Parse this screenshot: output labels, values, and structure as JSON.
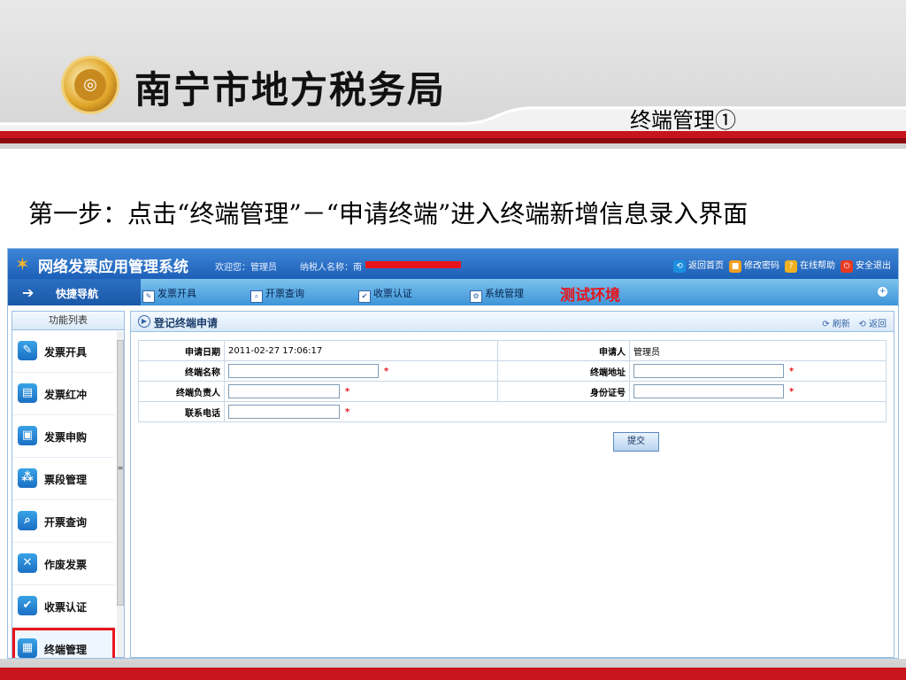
{
  "slide": {
    "bureau_name": "南宁市地方税务局",
    "slide_title": "终端管理①",
    "instruction": "第一步：点击“终端管理”－“申请终端”进入终端新增信息录入界面"
  },
  "app": {
    "system_title": "网络发票应用管理系统",
    "welcome": "欢迎您：管理员",
    "taxpayer_label": "纳税人名称：南",
    "top_links": [
      {
        "label": "返回首页",
        "icon": "home-icon",
        "color": "#1c8fe0"
      },
      {
        "label": "修改密码",
        "icon": "lock-icon",
        "color": "#f0a020"
      },
      {
        "label": "在线帮助",
        "icon": "help-icon",
        "color": "#f0b020"
      },
      {
        "label": "安全退出",
        "icon": "power-icon",
        "color": "#e83a20"
      }
    ],
    "quick_nav": "快捷导航",
    "nav_items": [
      "发票开具",
      "开票查询",
      "收票认证",
      "系统管理"
    ],
    "test_env": "测试环境",
    "sidebar": {
      "header": "功能列表",
      "items": [
        "发票开具",
        "发票红冲",
        "发票申购",
        "票段管理",
        "开票查询",
        "作废发票",
        "收票认证",
        "终端管理"
      ]
    },
    "panel": {
      "title": "登记终端申请",
      "refresh": "刷新",
      "back": "返回",
      "fields": {
        "apply_date_label": "申请日期",
        "apply_date_value": "2011-02-27 17:06:17",
        "applicant_label": "申请人",
        "applicant_value": "管理员",
        "terminal_name_label": "终端名称",
        "terminal_address_label": "终端地址",
        "terminal_owner_label": "终端负责人",
        "id_number_label": "身份证号",
        "phone_label": "联系电话"
      },
      "required_mark": "*",
      "submit": "提交"
    }
  }
}
